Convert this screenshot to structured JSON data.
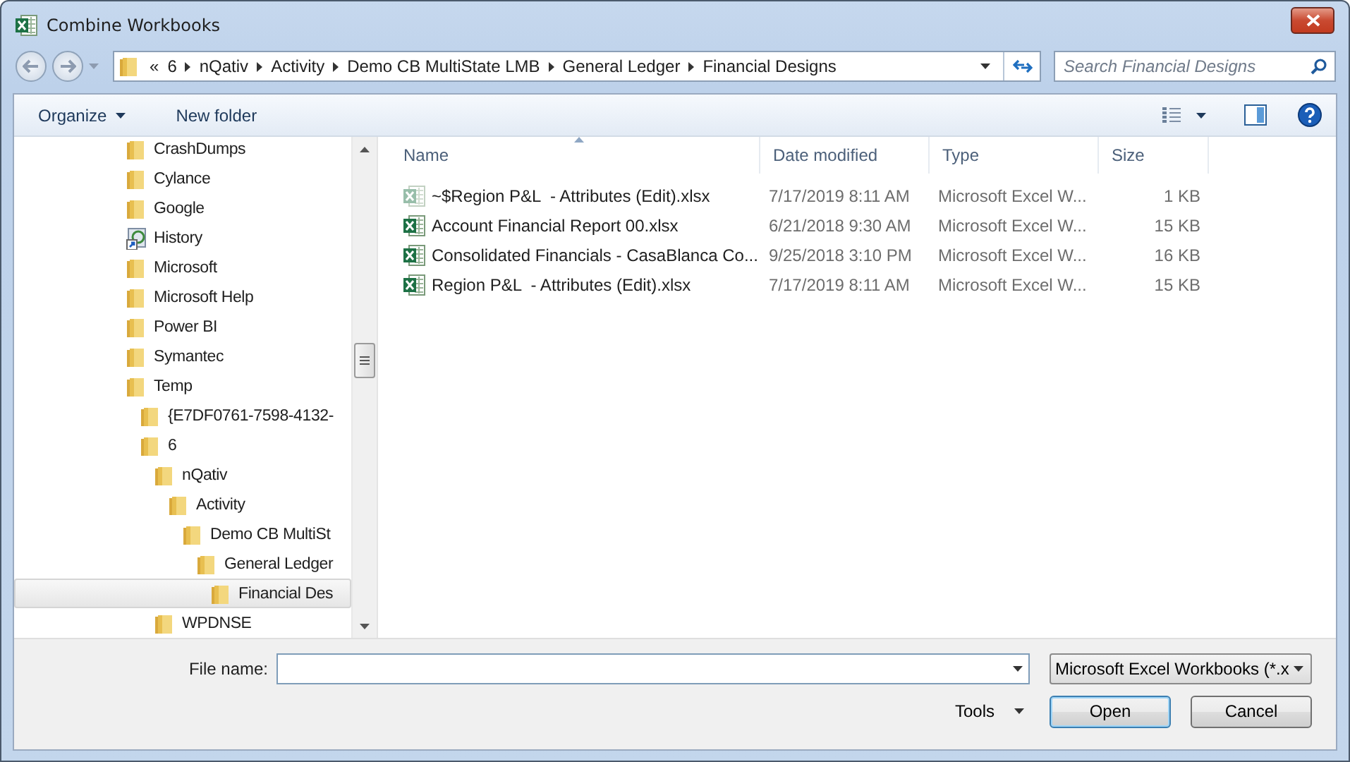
{
  "window": {
    "title": "Combine Workbooks"
  },
  "address_bar": {
    "overflow": "«",
    "crumbs": [
      "6",
      "nQativ",
      "Activity",
      "Demo CB MultiState LMB",
      "General Ledger",
      "Financial Designs"
    ]
  },
  "search": {
    "placeholder": "Search Financial Designs"
  },
  "toolbar": {
    "organize": "Organize",
    "new_folder": "New folder"
  },
  "tree": [
    {
      "label": "CrashDumps",
      "kind": "folder",
      "selected": false
    },
    {
      "label": "Cylance",
      "kind": "folder",
      "selected": false
    },
    {
      "label": "Google",
      "kind": "folder",
      "selected": false
    },
    {
      "label": "History",
      "kind": "shortcut",
      "selected": false
    },
    {
      "label": "Microsoft",
      "kind": "folder",
      "selected": false
    },
    {
      "label": "Microsoft Help",
      "kind": "folder",
      "selected": false
    },
    {
      "label": "Power BI",
      "kind": "folder",
      "selected": false
    },
    {
      "label": "Symantec",
      "kind": "folder",
      "selected": false
    },
    {
      "label": "Temp",
      "kind": "folder",
      "selected": false,
      "children": [
        {
          "label": "{E7DF0761-7598-4132-",
          "kind": "folder",
          "selected": false
        },
        {
          "label": "6",
          "kind": "folder",
          "selected": false,
          "children": [
            {
              "label": "nQativ",
              "kind": "folder",
              "selected": false,
              "children": [
                {
                  "label": "Activity",
                  "kind": "folder",
                  "selected": false,
                  "children": [
                    {
                      "label": "Demo CB MultiSt",
                      "kind": "folder",
                      "selected": false,
                      "children": [
                        {
                          "label": "General Ledger",
                          "kind": "folder",
                          "selected": false,
                          "children": [
                            {
                              "label": "Financial Des",
                              "kind": "folder",
                              "selected": true
                            }
                          ]
                        }
                      ]
                    }
                  ]
                }
              ]
            },
            {
              "label": "WPDNSE",
              "kind": "folder",
              "selected": false
            }
          ]
        }
      ]
    }
  ],
  "file_list": {
    "columns": [
      {
        "label": "Name",
        "sorted": true
      },
      {
        "label": "Date modified",
        "sorted": false
      },
      {
        "label": "Type",
        "sorted": false
      },
      {
        "label": "Size",
        "sorted": false
      }
    ],
    "rows": [
      {
        "name": "~$Region P&L  - Attributes (Edit).xlsx",
        "date": "7/17/2019 8:11 AM",
        "type": "Microsoft Excel W...",
        "size": "1 KB",
        "hidden": true
      },
      {
        "name": "Account Financial Report 00.xlsx",
        "date": "6/21/2018 9:30 AM",
        "type": "Microsoft Excel W...",
        "size": "15 KB",
        "hidden": false
      },
      {
        "name": "Consolidated Financials - CasaBlanca Co...",
        "date": "9/25/2018 3:10 PM",
        "type": "Microsoft Excel W...",
        "size": "16 KB",
        "hidden": false
      },
      {
        "name": "Region P&L  - Attributes (Edit).xlsx",
        "date": "7/17/2019 8:11 AM",
        "type": "Microsoft Excel W...",
        "size": "15 KB",
        "hidden": false
      }
    ]
  },
  "footer": {
    "file_name_label": "File name:",
    "file_type": "Microsoft Excel Workbooks (*.x",
    "tools": "Tools",
    "open": "Open",
    "cancel": "Cancel"
  }
}
